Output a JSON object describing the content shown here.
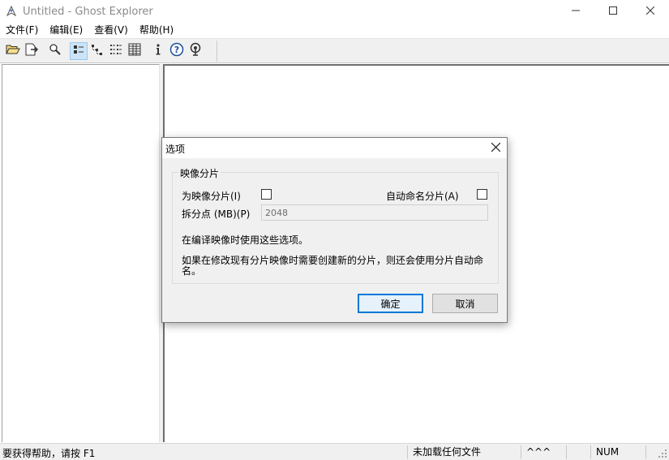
{
  "window": {
    "title": "Untitled - Ghost Explorer",
    "controls": [
      "minimize-icon",
      "maximize-icon",
      "close-icon"
    ]
  },
  "menu": [
    "文件(F)",
    "编辑(E)",
    "查看(V)",
    "帮助(H)"
  ],
  "toolbar": {
    "buttons": [
      "open-folder-icon",
      "extract-icon",
      "find-icon",
      "large-icons-view-icon",
      "tree-view-icon",
      "list-view-icon",
      "details-view-icon",
      "info-icon",
      "help-icon",
      "connect-icon"
    ],
    "active": "large-icons-view-icon"
  },
  "status": {
    "help": "要获得帮助，请按 F1",
    "file_state": "未加载任何文件",
    "caps": "^^^",
    "num": "NUM"
  },
  "dialog": {
    "title": "选项",
    "group_label": "映像分片",
    "span_image_label": "为映像分片(I)",
    "span_image_checked": false,
    "autoname_label": "自动命名分片(A)",
    "autoname_checked": false,
    "split_point_label": "拆分点 (MB)(P)",
    "split_point_value": "2048",
    "note1": "在编译映像时使用这些选项。",
    "note2_line1": "如果在修改现有分片映像时需要创建新的分片，则还会使用分片自动命",
    "note2_line2": "名。",
    "ok_label": "确定",
    "cancel_label": "取消"
  },
  "colors": {
    "accent": "#0078d7",
    "toolbar_bg": "#f0f0f0",
    "title_gray": "#8a8a8a"
  }
}
